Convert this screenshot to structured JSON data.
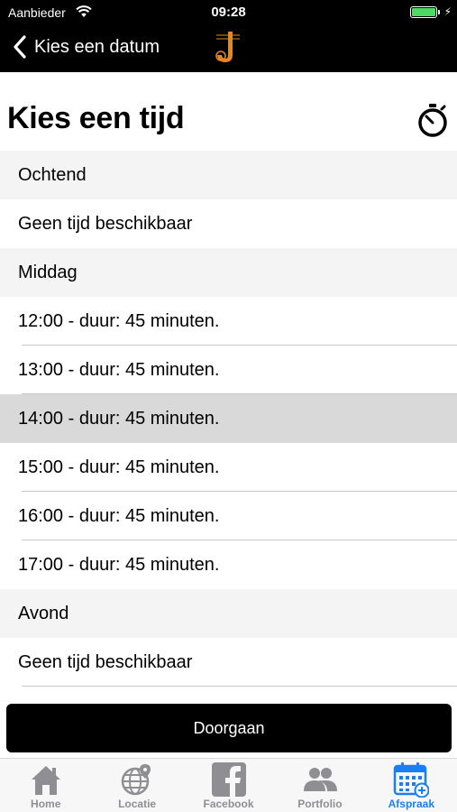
{
  "status_bar": {
    "carrier": "Aanbieder",
    "time": "09:28"
  },
  "nav": {
    "back_label": "Kies een datum"
  },
  "page": {
    "title": "Kies een tijd"
  },
  "sections": [
    {
      "header": "Ochtend",
      "rows": [
        "Geen tijd beschikbaar"
      ]
    },
    {
      "header": "Middag",
      "rows": [
        "12:00 - duur: 45 minuten.",
        "13:00 - duur: 45 minuten.",
        "14:00 - duur: 45 minuten.",
        "15:00 - duur: 45 minuten.",
        "16:00 - duur: 45 minuten.",
        "17:00 - duur: 45 minuten."
      ]
    },
    {
      "header": "Avond",
      "rows": [
        "Geen tijd beschikbaar"
      ]
    }
  ],
  "selected_row": "14:00 - duur: 45 minuten.",
  "continue_button": {
    "label": "Doorgaan"
  },
  "tabbar": {
    "items": [
      {
        "label": "Home",
        "icon": "home-icon"
      },
      {
        "label": "Locatie",
        "icon": "globe-pin-icon"
      },
      {
        "label": "Facebook",
        "icon": "facebook-icon"
      },
      {
        "label": "Portfolio",
        "icon": "people-icon"
      },
      {
        "label": "Afspraak",
        "icon": "calendar-add-icon"
      }
    ],
    "active": "Afspraak"
  },
  "colors": {
    "accent": "#1a7ff6",
    "inactive": "#8e8e93",
    "battery": "#4cd964",
    "logo": "#e8871e",
    "selected_row": "#d9d9d9"
  }
}
